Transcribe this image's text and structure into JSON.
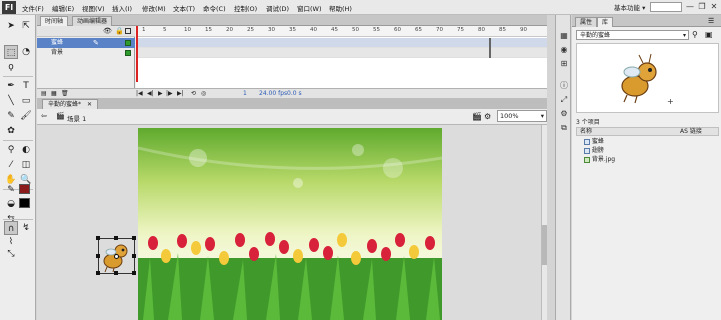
{
  "app": {
    "logo": "Fl"
  },
  "menu": [
    "文件(F)",
    "编辑(E)",
    "视图(V)",
    "插入(I)",
    "修改(M)",
    "文本(T)",
    "命令(C)",
    "控制(O)",
    "调试(D)",
    "窗口(W)",
    "帮助(H)"
  ],
  "workspace": {
    "label": "基本功能 ▾"
  },
  "window_controls": {
    "minimize": "—",
    "restore": "❐",
    "close": "✕"
  },
  "timeline": {
    "tabs": [
      "时间轴",
      "动画编辑器"
    ],
    "layers": [
      {
        "name": "蜜蜂",
        "active": true
      },
      {
        "name": "背景",
        "active": false
      }
    ],
    "frame_numbers": [
      "1",
      "5",
      "10",
      "15",
      "20",
      "25",
      "30",
      "35",
      "40",
      "45",
      "50",
      "55",
      "60",
      "65",
      "70",
      "75",
      "80",
      "85",
      "90"
    ],
    "footer": {
      "current_frame": "1",
      "fps": "24.00 fps",
      "time": "0.0 s"
    }
  },
  "document": {
    "tab": "辛勤的蜜蜂*",
    "scene": "场景 1",
    "zoom": "100%"
  },
  "right_panel": {
    "tabs": [
      "属性",
      "库"
    ],
    "library_select": "辛勤的蜜蜂",
    "item_count": "3 个项目",
    "header": {
      "name": "名称",
      "linkage": "AS 链接"
    },
    "items": [
      {
        "name": "蜜蜂",
        "kind": "symbol"
      },
      {
        "name": "翅膀",
        "kind": "symbol"
      },
      {
        "name": "背景.jpg",
        "kind": "bitmap"
      }
    ]
  },
  "colors": {
    "accent": "#5a82c6",
    "stroke": "#8b1a1a",
    "fill": "#000000",
    "playhead": "#dd2222"
  }
}
